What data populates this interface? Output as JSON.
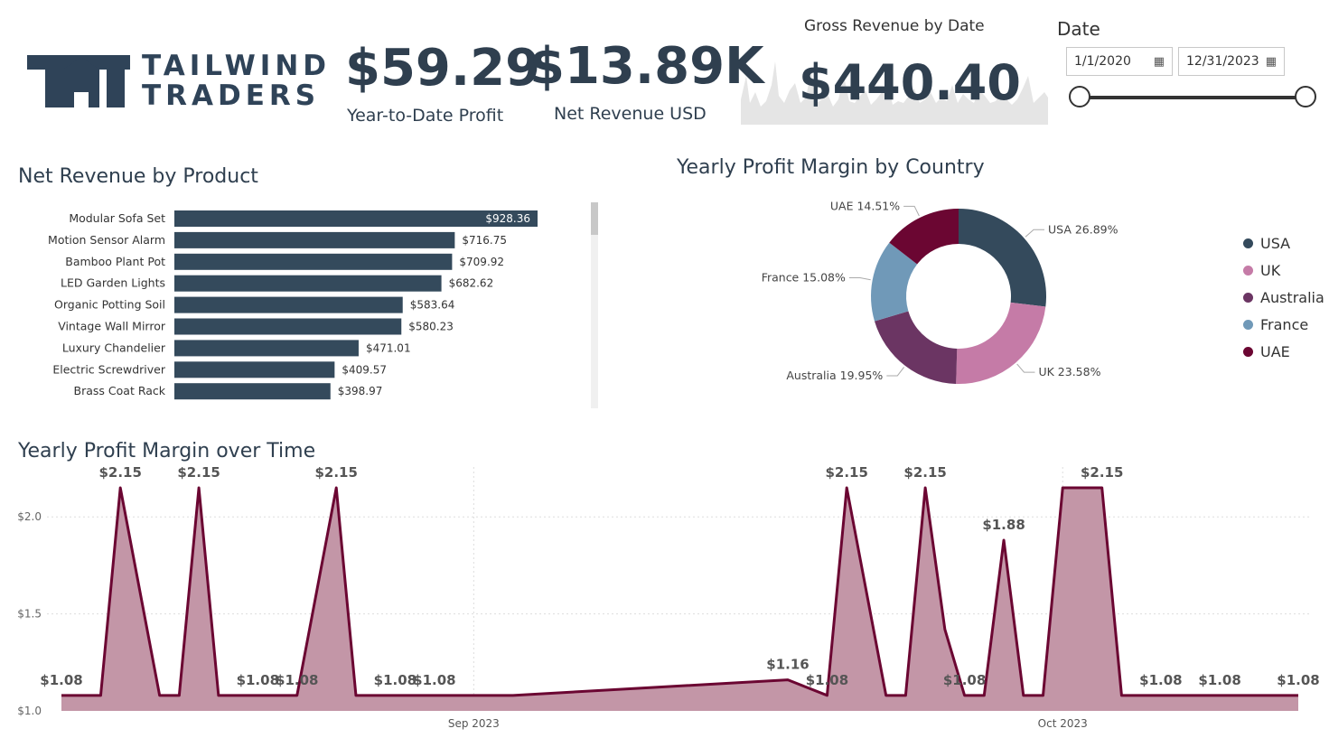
{
  "logo": {
    "line1": "TAILWIND",
    "line2": "TRADERS"
  },
  "kpis": {
    "ytd_profit": {
      "value": "$59.29",
      "label": "Year-to-Date Profit"
    },
    "net_revenue": {
      "value": "$13.89K",
      "label": "Net Revenue USD"
    },
    "gross_revenue": {
      "title": "Gross Revenue by Date",
      "value": "$440.40"
    }
  },
  "date_filter": {
    "title": "Date",
    "start": "1/1/2020",
    "end": "12/31/2023",
    "slider_range": [
      0,
      1
    ]
  },
  "colors": {
    "dark_slate": "#344a5c",
    "pink": "#c57ba7",
    "purple": "#6b3563",
    "blue": "#7099b8",
    "maroon": "#6b0632",
    "area_fill": "#c396a7",
    "sparkline": "#e8e8e8"
  },
  "icons": {
    "calendar": "calendar-icon"
  },
  "net_revenue_by_product": {
    "title": "Net Revenue by Product",
    "chart_data": {
      "type": "bar",
      "orientation": "horizontal",
      "categories": [
        "Modular Sofa Set",
        "Motion Sensor Alarm",
        "Bamboo Plant Pot",
        "LED Garden Lights",
        "Organic Potting Soil",
        "Vintage Wall Mirror",
        "Luxury Chandelier",
        "Electric Screwdriver",
        "Brass Coat Rack"
      ],
      "values": [
        928.36,
        716.75,
        709.92,
        682.62,
        583.64,
        580.23,
        471.01,
        409.57,
        398.97
      ],
      "value_labels": [
        "$928.36",
        "$716.75",
        "$709.92",
        "$682.62",
        "$583.64",
        "$580.23",
        "$471.01",
        "$409.57",
        "$398.97"
      ],
      "xlim": [
        0,
        928.36
      ]
    }
  },
  "profit_margin_by_country": {
    "title": "Yearly Profit Margin by Country",
    "chart_data": {
      "type": "pie",
      "donut": true,
      "categories": [
        "USA",
        "UK",
        "Australia",
        "France",
        "UAE"
      ],
      "values": [
        26.89,
        23.58,
        19.95,
        15.08,
        14.51
      ],
      "labels": [
        "USA 26.89%",
        "UK 23.58%",
        "Australia 19.95%",
        "France 15.08%",
        "UAE 14.51%"
      ],
      "colors": [
        "#344a5c",
        "#c57ba7",
        "#6b3563",
        "#7099b8",
        "#6b0632"
      ],
      "legend_position": "right"
    }
  },
  "profit_margin_over_time": {
    "title": "Yearly Profit Margin over Time",
    "chart_data": {
      "type": "area",
      "x_ticks": [
        "Sep 2023",
        "Oct 2023"
      ],
      "y_ticks": [
        "$1.0",
        "$1.5",
        "$2.0"
      ],
      "ylim": [
        1.0,
        2.15
      ],
      "grid": true,
      "points": [
        {
          "x": "2023-08-11",
          "y": 1.08,
          "label": "$1.08"
        },
        {
          "x": "2023-08-13",
          "y": 1.08,
          "label": ""
        },
        {
          "x": "2023-08-14",
          "y": 2.15,
          "label": "$2.15"
        },
        {
          "x": "2023-08-16",
          "y": 1.08,
          "label": ""
        },
        {
          "x": "2023-08-17",
          "y": 1.08,
          "label": ""
        },
        {
          "x": "2023-08-18",
          "y": 2.15,
          "label": "$2.15"
        },
        {
          "x": "2023-08-19",
          "y": 1.08,
          "label": ""
        },
        {
          "x": "2023-08-21",
          "y": 1.08,
          "label": "$1.08"
        },
        {
          "x": "2023-08-23",
          "y": 1.08,
          "label": "$1.08"
        },
        {
          "x": "2023-08-25",
          "y": 2.15,
          "label": "$2.15"
        },
        {
          "x": "2023-08-26",
          "y": 1.08,
          "label": ""
        },
        {
          "x": "2023-08-28",
          "y": 1.08,
          "label": "$1.08"
        },
        {
          "x": "2023-08-30",
          "y": 1.08,
          "label": "$1.08"
        },
        {
          "x": "2023-09-03",
          "y": 1.08,
          "label": ""
        },
        {
          "x": "2023-09-17",
          "y": 1.16,
          "label": "$1.16"
        },
        {
          "x": "2023-09-19",
          "y": 1.08,
          "label": "$1.08"
        },
        {
          "x": "2023-09-20",
          "y": 2.15,
          "label": "$2.15"
        },
        {
          "x": "2023-09-22",
          "y": 1.08,
          "label": ""
        },
        {
          "x": "2023-09-23",
          "y": 1.08,
          "label": ""
        },
        {
          "x": "2023-09-24",
          "y": 2.15,
          "label": "$2.15"
        },
        {
          "x": "2023-09-25",
          "y": 1.42,
          "label": ""
        },
        {
          "x": "2023-09-26",
          "y": 1.08,
          "label": "$1.08"
        },
        {
          "x": "2023-09-27",
          "y": 1.08,
          "label": ""
        },
        {
          "x": "2023-09-28",
          "y": 1.88,
          "label": "$1.88"
        },
        {
          "x": "2023-09-29",
          "y": 1.08,
          "label": ""
        },
        {
          "x": "2023-09-30",
          "y": 1.08,
          "label": ""
        },
        {
          "x": "2023-10-01",
          "y": 2.15,
          "label": ""
        },
        {
          "x": "2023-10-03",
          "y": 2.15,
          "label": "$2.15"
        },
        {
          "x": "2023-10-04",
          "y": 1.08,
          "label": ""
        },
        {
          "x": "2023-10-06",
          "y": 1.08,
          "label": "$1.08"
        },
        {
          "x": "2023-10-09",
          "y": 1.08,
          "label": "$1.08"
        },
        {
          "x": "2023-10-13",
          "y": 1.08,
          "label": "$1.08"
        }
      ]
    }
  }
}
